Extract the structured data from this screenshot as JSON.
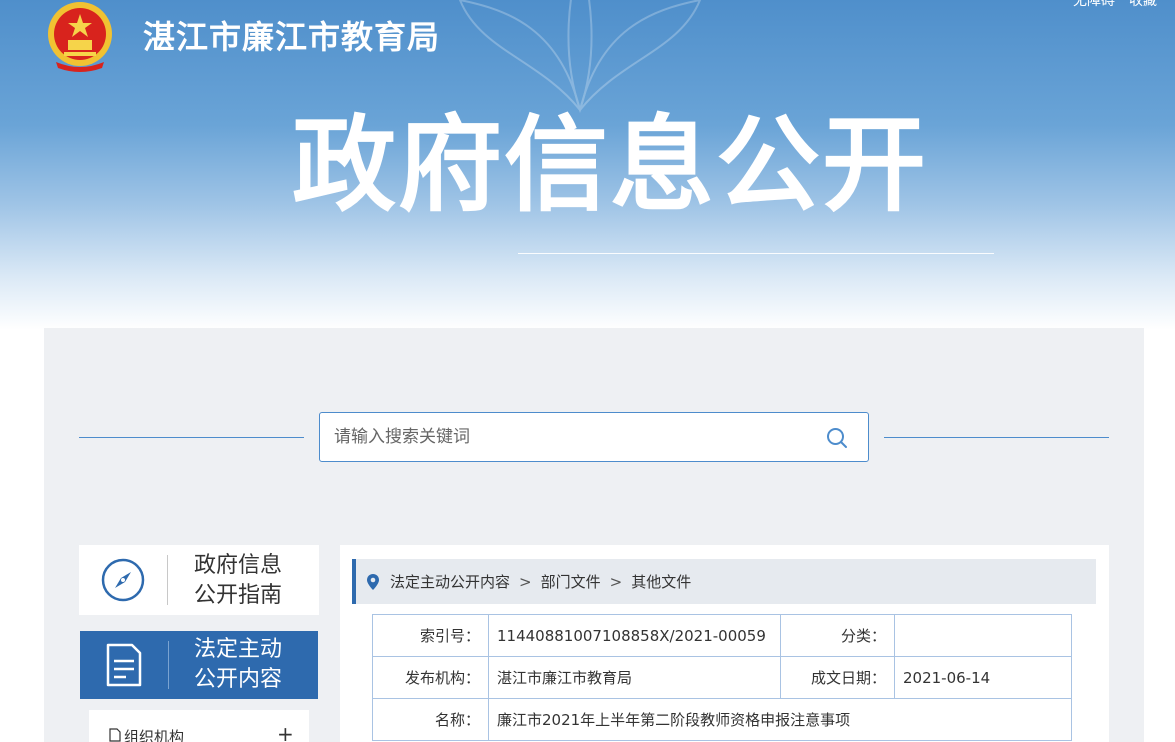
{
  "header": {
    "site_title": "湛江市廉江市教育局",
    "top_links": [
      "无障碍",
      "收藏"
    ],
    "banner_title": "政府信息公开"
  },
  "search": {
    "placeholder": "请输入搜索关键词",
    "icon": "search-icon"
  },
  "sidebar": {
    "guide_line1": "政府信息",
    "guide_line2": "公开指南",
    "active_line1": "法定主动",
    "active_line2": "公开内容",
    "sub_item_label": "组织机构",
    "sub_item_toggle": "+"
  },
  "breadcrumb": {
    "items": [
      "法定主动公开内容",
      "部门文件",
      "其他文件"
    ],
    "separator": ">"
  },
  "info_table": {
    "index_label": "索引号：",
    "index_value": "11440881007108858X/2021-00059",
    "category_label": "分类：",
    "category_value": "",
    "publisher_label": "发布机构：",
    "publisher_value": "湛江市廉江市教育局",
    "date_label": "成文日期：",
    "date_value": "2021-06-14",
    "name_label": "名称：",
    "name_value": "廉江市2021年上半年第二阶段教师资格申报注意事项"
  },
  "colors": {
    "primary": "#2e6aae",
    "accent_line": "#4d8ccc",
    "panel_bg": "#eef0f3",
    "table_border": "#a9c3e3"
  }
}
